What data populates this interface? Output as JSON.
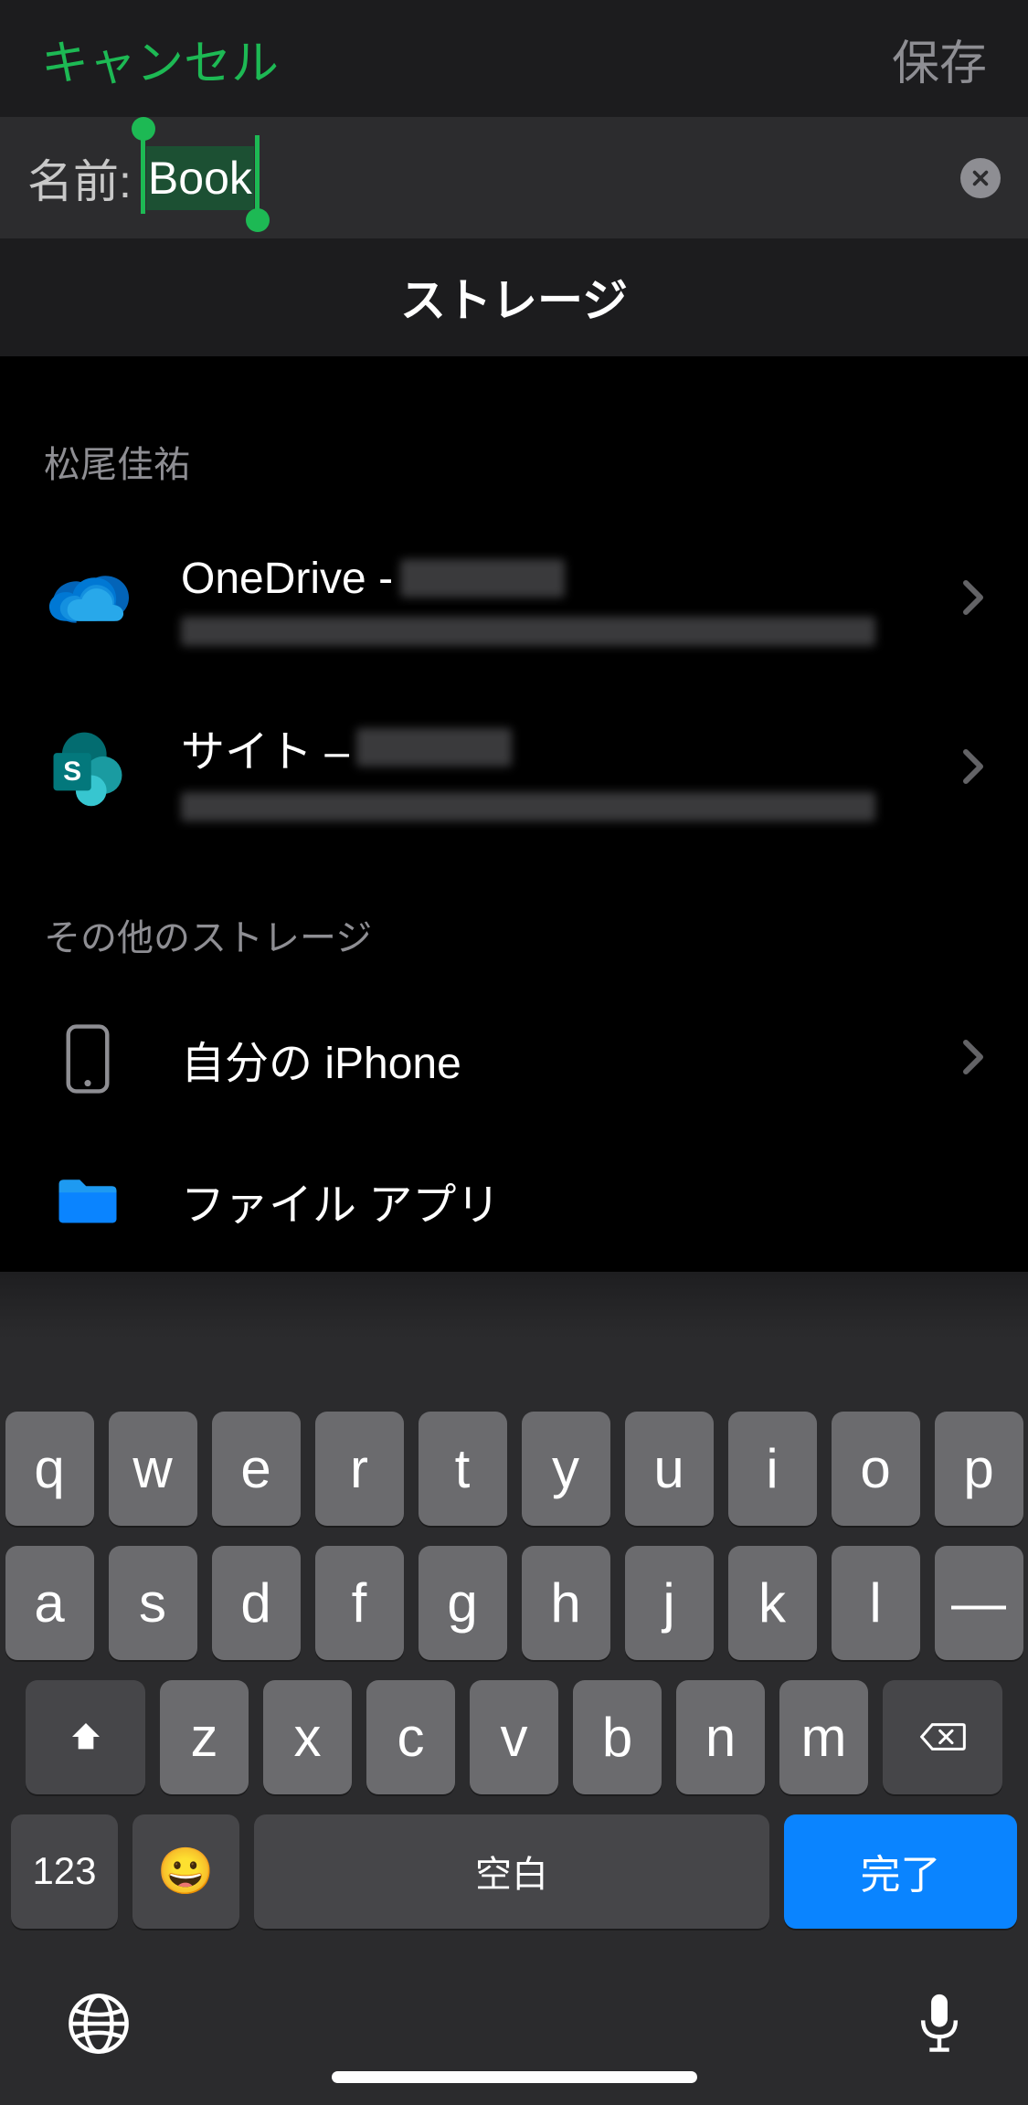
{
  "header": {
    "cancel": "キャンセル",
    "save": "保存"
  },
  "name_field": {
    "label": "名前:",
    "value": "Book"
  },
  "storage": {
    "header": "ストレージ",
    "account_section_label": "松尾佳祐",
    "other_section_label": "その他のストレージ",
    "items": [
      {
        "title_prefix": "OneDrive - ",
        "icon": "onedrive"
      },
      {
        "title_prefix": "サイト – ",
        "icon": "sharepoint"
      }
    ],
    "other_items": [
      {
        "title": "自分の iPhone",
        "icon": "iphone"
      },
      {
        "title": "ファイル アプリ",
        "icon": "files"
      }
    ]
  },
  "keyboard": {
    "rows": [
      [
        "q",
        "w",
        "e",
        "r",
        "t",
        "y",
        "u",
        "i",
        "o",
        "p"
      ],
      [
        "a",
        "s",
        "d",
        "f",
        "g",
        "h",
        "j",
        "k",
        "l",
        "—"
      ],
      [
        "z",
        "x",
        "c",
        "v",
        "b",
        "n",
        "m"
      ]
    ],
    "num_key": "123",
    "space": "空白",
    "done": "完了"
  }
}
